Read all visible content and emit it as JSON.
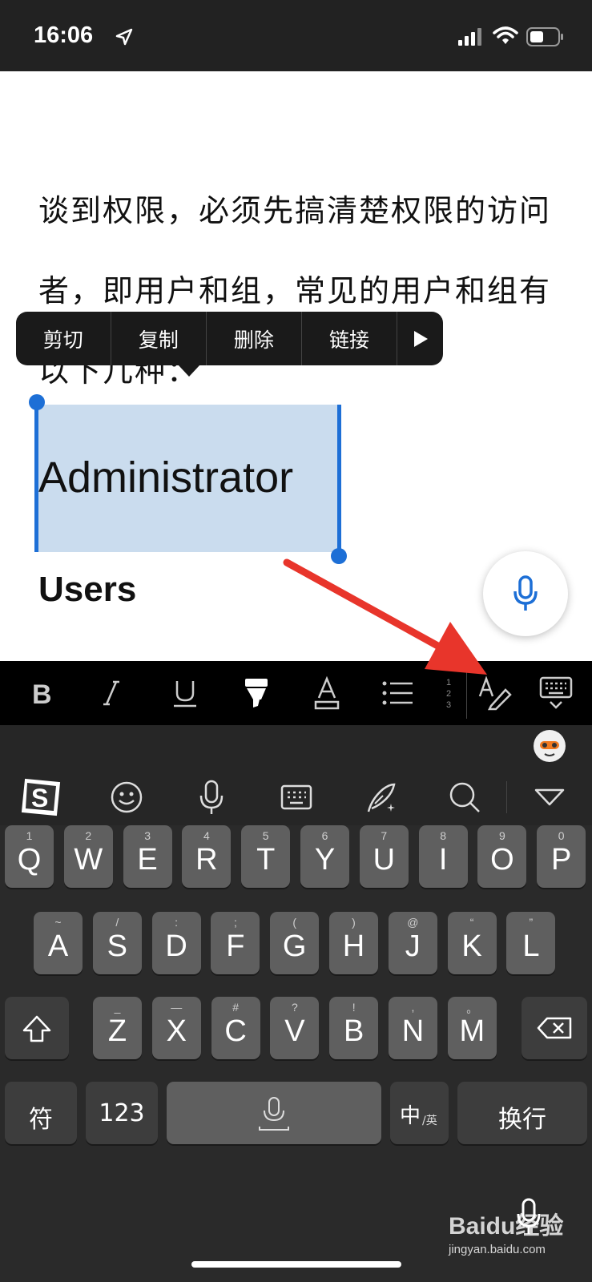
{
  "status_bar": {
    "time": "16:06"
  },
  "document": {
    "paragraph_lines": [
      "谈到权限，必须先搞清楚权限的访问",
      "者，即用户和组，常见的用户和组有",
      "以下几种："
    ],
    "selected_text": "Administrator",
    "heading": "Users"
  },
  "context_menu": {
    "items": [
      "剪切",
      "复制",
      "删除",
      "链接"
    ]
  },
  "format_toolbar": {
    "buttons": [
      "bold-icon",
      "italic-icon",
      "underline-icon",
      "highlighter-icon",
      "font-color-icon",
      "list-icon",
      "numbered-list-icon",
      "draw-pen-icon",
      "keyboard-dismiss-icon"
    ]
  },
  "keyboard": {
    "ime_toolbar": [
      "sogou-logo-icon",
      "emoji-icon",
      "voice-icon",
      "keyboard-layout-icon",
      "handwriting-icon",
      "search-icon",
      "collapse-icon"
    ],
    "row1": [
      {
        "main": "Q",
        "sub": "1"
      },
      {
        "main": "W",
        "sub": "2"
      },
      {
        "main": "E",
        "sub": "3"
      },
      {
        "main": "R",
        "sub": "4"
      },
      {
        "main": "T",
        "sub": "5"
      },
      {
        "main": "Y",
        "sub": "6"
      },
      {
        "main": "U",
        "sub": "7"
      },
      {
        "main": "I",
        "sub": "8"
      },
      {
        "main": "O",
        "sub": "9"
      },
      {
        "main": "P",
        "sub": "0"
      }
    ],
    "row2": [
      {
        "main": "A",
        "sub": "~"
      },
      {
        "main": "S",
        "sub": "/"
      },
      {
        "main": "D",
        "sub": ":"
      },
      {
        "main": "F",
        "sub": ";"
      },
      {
        "main": "G",
        "sub": "("
      },
      {
        "main": "H",
        "sub": ")"
      },
      {
        "main": "J",
        "sub": "@"
      },
      {
        "main": "K",
        "sub": "“"
      },
      {
        "main": "L",
        "sub": "”"
      }
    ],
    "row3": [
      {
        "main": "Z",
        "sub": "_"
      },
      {
        "main": "X",
        "sub": "—"
      },
      {
        "main": "C",
        "sub": "#"
      },
      {
        "main": "V",
        "sub": "?"
      },
      {
        "main": "B",
        "sub": "!"
      },
      {
        "main": "N",
        "sub": ","
      },
      {
        "main": "M",
        "sub": "。"
      }
    ],
    "symbol_key": "符",
    "number_key": "123",
    "lang_key_main": "中",
    "lang_key_sub": "/英",
    "enter_key": "换行"
  },
  "watermark": {
    "title": "Baidu经验",
    "url": "jingyan.baidu.com"
  },
  "colors": {
    "selection": "#cadcee",
    "accent": "#1d6fd6",
    "arrow": "#e8352b"
  }
}
